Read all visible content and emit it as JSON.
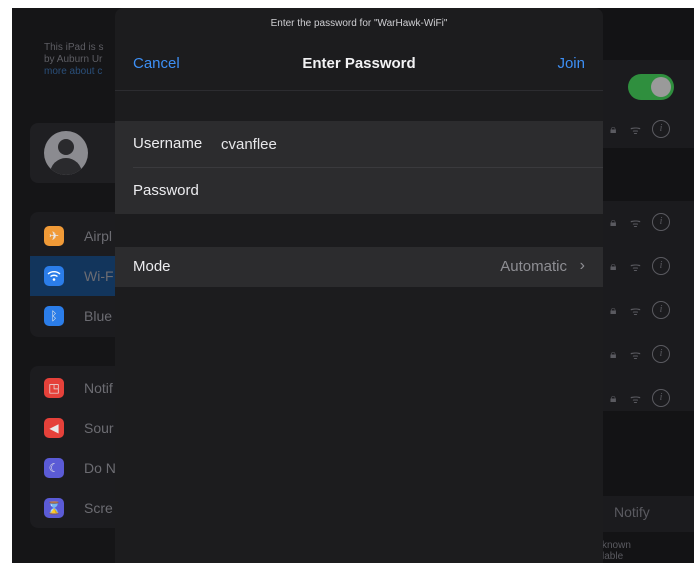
{
  "modal": {
    "prompt": "Enter the password for \"WarHawk-WiFi\"",
    "title": "Enter Password",
    "cancel_label": "Cancel",
    "join_label": "Join",
    "username_label": "Username",
    "username_value": "cvanflee",
    "password_label": "Password",
    "password_value": "",
    "mode_label": "Mode",
    "mode_value": "Automatic",
    "mode_chevron_icon": "chevron-right-icon"
  },
  "background": {
    "sidebar_note_line1": "This iPad is s",
    "sidebar_note_line2": "by Auburn Ur",
    "sidebar_note_link": "more about c",
    "sidebar_items": [
      {
        "label": "Airpl",
        "icon": "airplane-icon",
        "color": "#f09a37"
      },
      {
        "label": "Wi-F",
        "icon": "wifi-icon",
        "color": "#2b7de9"
      },
      {
        "label": "Blue",
        "icon": "bluetooth-icon",
        "color": "#2b7de9"
      },
      {
        "label": "Notif",
        "icon": "notifications-icon",
        "color": "#e5413a"
      },
      {
        "label": "Sour",
        "icon": "sound-icon",
        "color": "#e5413a"
      },
      {
        "label": "Do N",
        "icon": "moon-icon",
        "color": "#5b5bd6"
      },
      {
        "label": "Scre",
        "icon": "hourglass-icon",
        "color": "#5b5bd6"
      }
    ],
    "wifi_toggle": "on",
    "notify_label": "Notify",
    "known_text_line1": "known",
    "known_text_line2": "lable"
  },
  "colors": {
    "accent": "#3d8ff5",
    "toggle_on": "#2f8f3e",
    "modal_bg": "#1c1c1e",
    "row_bg": "#2c2c2e"
  }
}
